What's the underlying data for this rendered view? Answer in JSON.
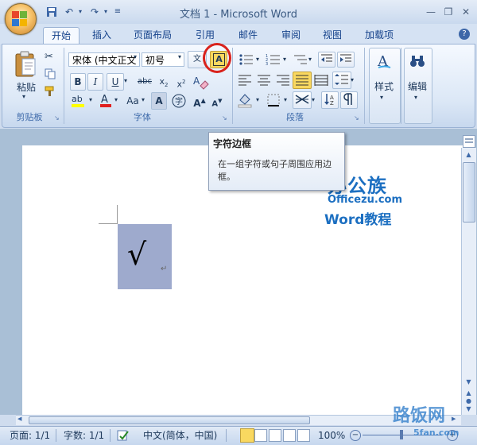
{
  "window": {
    "title": "文档 1 - Microsoft Word"
  },
  "tabs": [
    "开始",
    "插入",
    "页面布局",
    "引用",
    "邮件",
    "审阅",
    "视图",
    "加载项"
  ],
  "clipboard": {
    "paste_label": "粘贴",
    "group_label": "剪贴板"
  },
  "font": {
    "font_name": "宋体 (中文正文",
    "font_size": "初号",
    "group_label": "字体",
    "wen_label": "文",
    "aa_label": "Aa"
  },
  "paragraph": {
    "group_label": "段落"
  },
  "styles": {
    "label": "样式",
    "icon_letter": "A"
  },
  "edit": {
    "label": "编辑"
  },
  "tooltip": {
    "title": "字符边框",
    "body": "在一组字符或句子周围应用边框。"
  },
  "document": {
    "checkmark": "√",
    "para_mark": "↵"
  },
  "watermark": {
    "brand": "办公族",
    "site": "Officezu.com",
    "course": "Word教程",
    "bottom_brand": "路饭网",
    "bottom_site": "5fan.com"
  },
  "status": {
    "page": "页面: 1/1",
    "words": "字数: 1/1",
    "lang": "中文(简体，中国)",
    "zoom": "100%"
  },
  "colors": {
    "accent_red": "#d9221c",
    "highlight": "#9eaacd",
    "ribbon_text": "#15428b"
  }
}
